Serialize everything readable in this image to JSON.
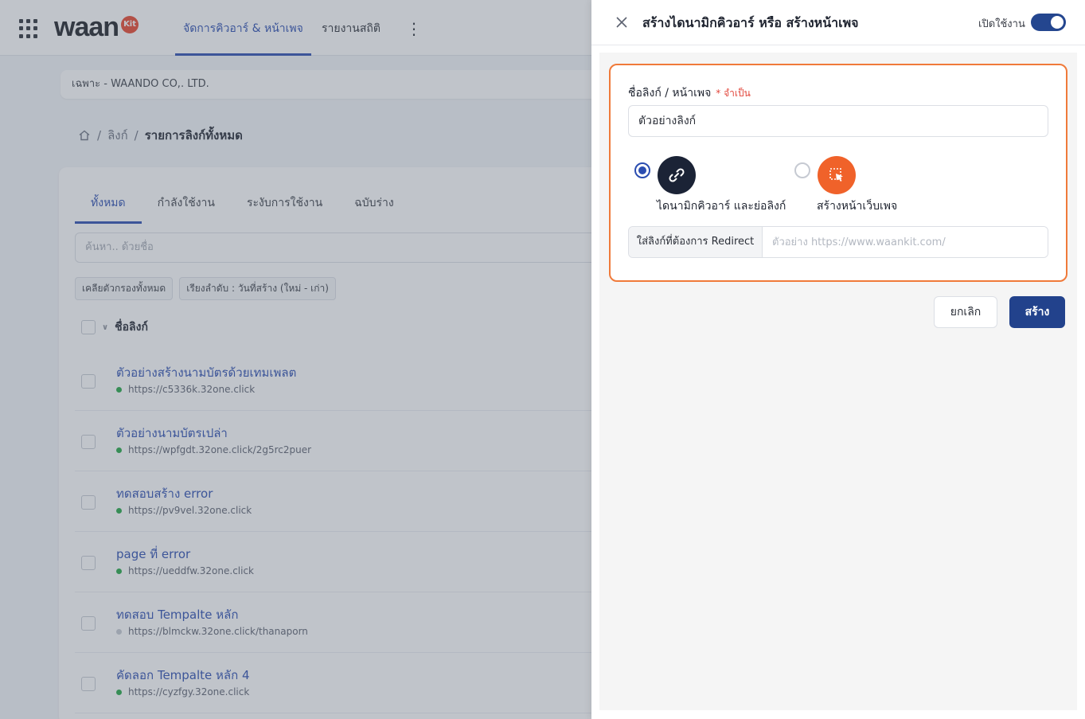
{
  "app": {
    "logo_text": "waan",
    "logo_badge": "Kit",
    "nav_tabs": [
      "จัดการคิวอาร์ & หน้าเพจ",
      "รายงานสถิติ"
    ],
    "more_icon": "more-vertical-icon"
  },
  "workspace": {
    "label": "เฉพาะ - WAANDO CO,. LTD."
  },
  "breadcrumb": {
    "items": [
      "ลิงก์",
      "รายการลิงก์ทั้งหมด"
    ]
  },
  "list": {
    "tabs": [
      "ทั้งหมด",
      "กำลังใช้งาน",
      "ระงับการใช้งาน",
      "ฉบับร่าง"
    ],
    "search_placeholder": "ค้นหา.. ด้วยชื่อ",
    "chips": [
      "เคลียตัวกรองทั้งหมด",
      "เรียงลำดับ : วันที่สร้าง (ใหม่ - เก่า)"
    ],
    "column_header": "ชื่อลิงก์",
    "rows": [
      {
        "title": "ตัวอย่างสร้างนามบัตรด้วยเทมเพลต",
        "url": "https://c5336k.32one.click",
        "status": "green"
      },
      {
        "title": "ตัวอย่างนามบัตรเปล่า",
        "url": "https://wpfgdt.32one.click/2g5rc2puer",
        "status": "green"
      },
      {
        "title": "ทดสอบสร้าง error",
        "url": "https://pv9vel.32one.click",
        "status": "green"
      },
      {
        "title": "page ที่ error",
        "url": "https://ueddfw.32one.click",
        "status": "green"
      },
      {
        "title": "ทดสอบ Tempalte หลัก",
        "url": "https://blmckw.32one.click/thanaporn",
        "status": "grey"
      },
      {
        "title": "คัดลอก Tempalte หลัก 4",
        "url": "https://cyzfgy.32one.click",
        "status": "green"
      }
    ]
  },
  "drawer": {
    "title": "สร้างไดนามิกคิวอาร์ หรือ สร้างหน้าเพจ",
    "enable_label": "เปิดใช้งาน",
    "enabled": true,
    "name_label": "ชื่อลิงก์ / หน้าเพจ",
    "required_text": "* จำเป็น",
    "name_value": "ตัวอย่างลิงก์",
    "options": [
      {
        "label": "ไดนามิกคิวอาร์ และย่อลิงก์",
        "icon": "link-icon",
        "selected": true
      },
      {
        "label": "สร้างหน้าเว็บเพจ",
        "icon": "page-select-icon",
        "selected": false
      }
    ],
    "redirect_label": "ใส่ลิงก์ที่ต้องการ Redirect",
    "redirect_placeholder": "ตัวอย่าง https://www.waankit.com/",
    "cancel_label": "ยกเลิก",
    "create_label": "สร้าง"
  },
  "colors": {
    "accent": "#2b4db0",
    "primary_button": "#22428c",
    "highlight_border": "#f07a3a",
    "web_page_icon_bg": "#f0622a",
    "link_icon_bg": "#1b2336"
  }
}
